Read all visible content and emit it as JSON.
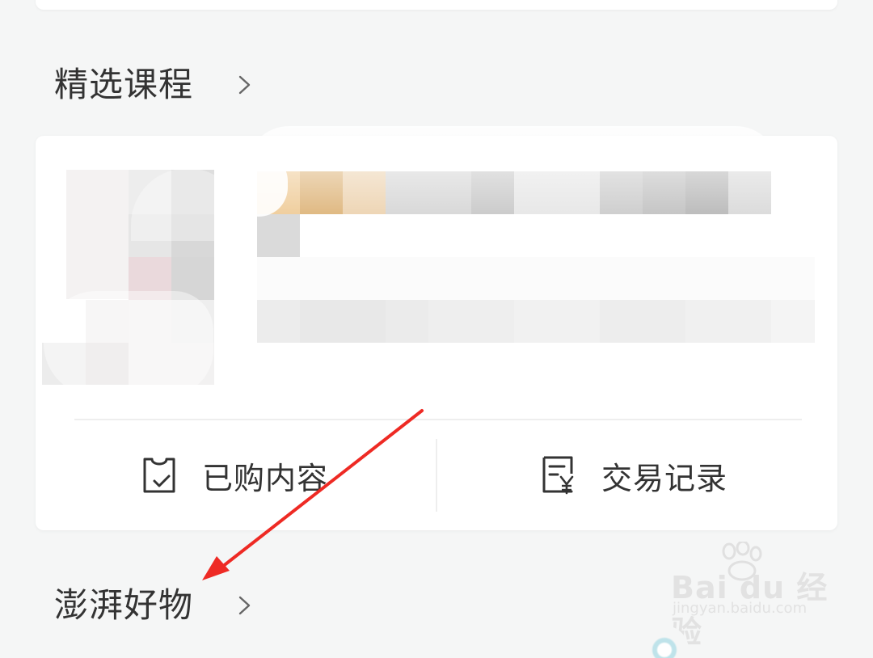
{
  "sections": {
    "courses_title": "精选课程",
    "goods_title": "澎湃好物"
  },
  "actions": {
    "purchased_label": "已购内容",
    "transactions_label": "交易记录"
  },
  "watermark": {
    "brand": "Bai du 经验",
    "url": "jingyan.baidu.com"
  },
  "icons": {
    "section_arrow": "chevron-right-icon",
    "purchased": "bag-check-icon",
    "transactions": "receipt-yen-icon"
  },
  "colors": {
    "background": "#f5f6f6",
    "card": "#ffffff",
    "text": "#333333",
    "annotation_arrow": "#ee2a24"
  }
}
